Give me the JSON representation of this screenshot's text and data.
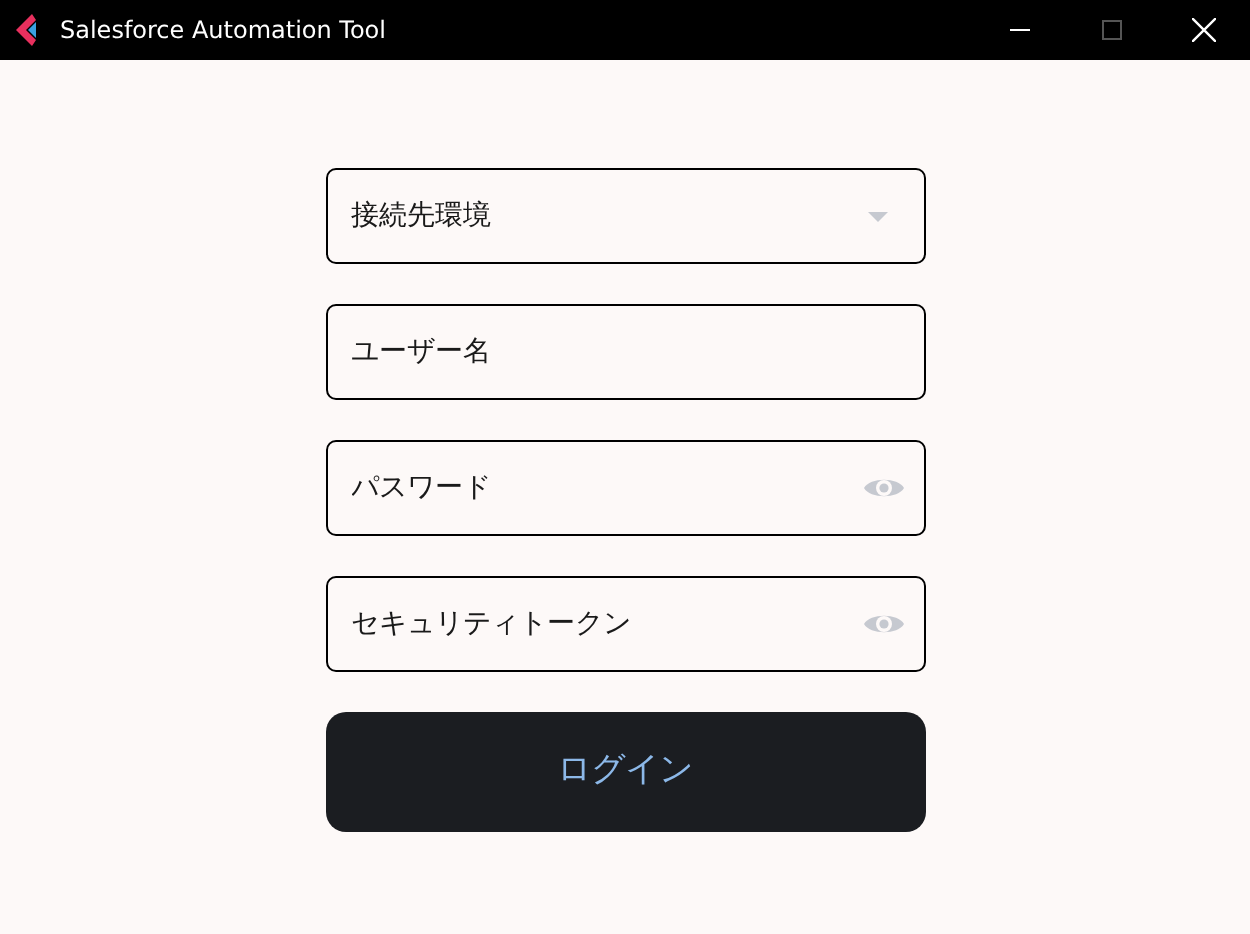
{
  "window": {
    "title": "Salesforce Automation Tool"
  },
  "fields": [
    {
      "kind": "select",
      "placeholder": "接続先環境"
    },
    {
      "kind": "text",
      "placeholder": "ユーザー名"
    },
    {
      "kind": "password",
      "placeholder": "パスワード"
    },
    {
      "kind": "password",
      "placeholder": "セキュリティトークン"
    }
  ],
  "login_button": "ログイン"
}
